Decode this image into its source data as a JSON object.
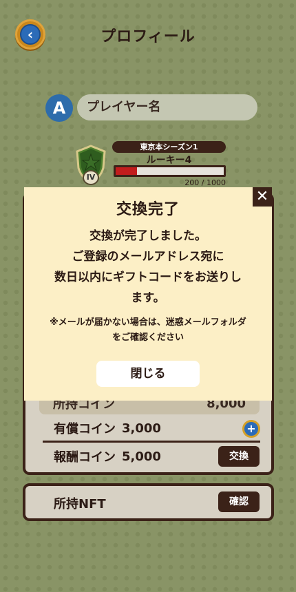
{
  "header": {
    "title": "プロフィール",
    "back_icon": "‹"
  },
  "player": {
    "badge": "A",
    "name": "プレイヤー名"
  },
  "rank": {
    "season": "東京本シーズン1",
    "name": "ルーキー4",
    "level_numeral": "IV",
    "exp_text": "200 / 1000",
    "exp_fraction": 0.2
  },
  "coins": {
    "total_label": "所持コイン",
    "total_value": "8,000",
    "paid_label": "有償コイン",
    "paid_value": "3,000",
    "reward_label": "報酬コイン",
    "reward_value": "5,000",
    "exchange_label": "交換",
    "plus_icon": "+"
  },
  "nft": {
    "label": "所持NFT",
    "confirm_label": "確認"
  },
  "modal": {
    "title": "交換完了",
    "close_icon": "✕",
    "message": "交換が完了しました。\nご登録のメールアドレス宛に\n数日以内にギフトコードをお送りし\nます。",
    "note": "※メールが届かない場合は、迷惑メールフォルダ\nをご確認ください",
    "close_button": "閉じる"
  },
  "colors": {
    "accent": "#3b2218",
    "background": "#9aa874",
    "modal": "#fcefc6",
    "exp_fill": "#c21d1d"
  }
}
